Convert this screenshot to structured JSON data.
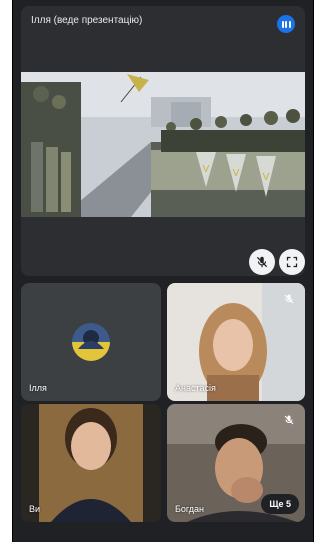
{
  "presentation": {
    "presenter_label": "Ілля (веде презентацію)",
    "shared_content_icon": "protest-photo"
  },
  "participants": [
    {
      "name": "Ілля",
      "muted": false,
      "type": "avatar"
    },
    {
      "name": "Анастасія",
      "muted": true,
      "type": "video"
    },
    {
      "name": "Ви",
      "muted": false,
      "type": "video"
    },
    {
      "name": "Богдан",
      "muted": true,
      "type": "video"
    }
  ],
  "more_participants_label": "Ще 5",
  "colors": {
    "background": "#202124",
    "tile": "#3c4043",
    "accent": "#1a73e8"
  }
}
